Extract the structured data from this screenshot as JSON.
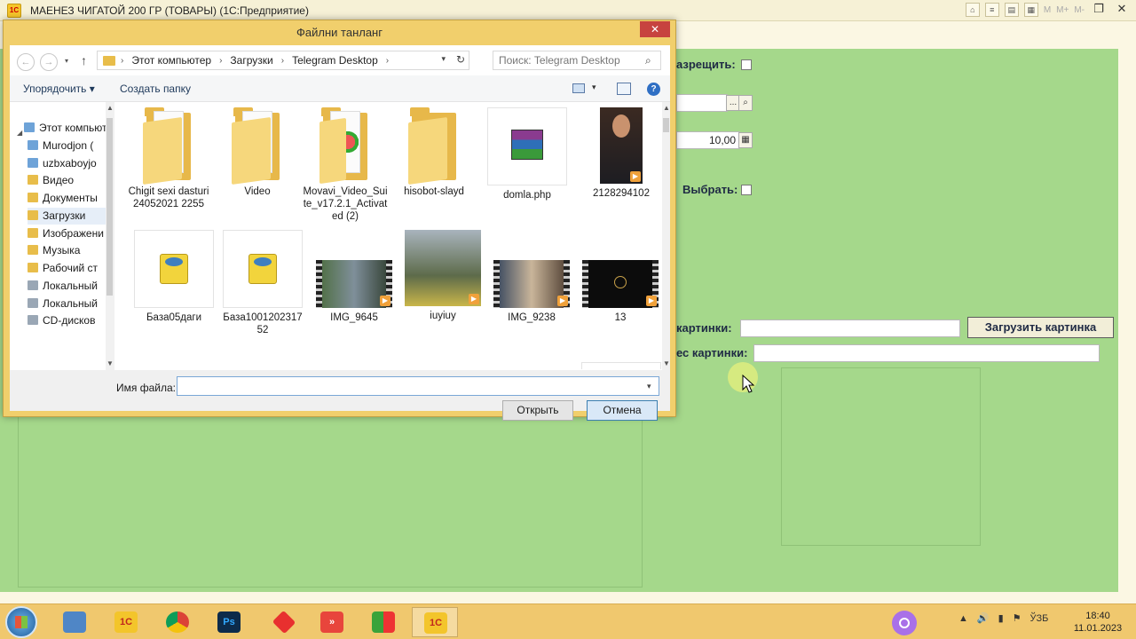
{
  "window": {
    "title": "МАЕНЕЗ ЧИГАТОЙ 200 ГР (ТОВАРЫ)  (1С:Предприятие)",
    "app_icon": "1С",
    "toolbar_m": [
      "M",
      "M+",
      "M-"
    ]
  },
  "form": {
    "fields": {
      "forbid_label": "азрещить:",
      "amount_value": "10,00",
      "select_label": "Выбрать:",
      "picture_label": "картинки:",
      "picture_path_label": "ес картинки:",
      "load_button": "Загрузить картинка",
      "ellipsis": "...",
      "search_glyph": "🔍"
    }
  },
  "dialog": {
    "title": "Файлни танланг",
    "close": "✕",
    "address": [
      "Этот компьютер",
      "Загрузки",
      "Telegram Desktop"
    ],
    "search_placeholder": "Поиск: Telegram Desktop",
    "toolbar": {
      "organize": "Упорядочить ▾",
      "new_folder": "Создать папку",
      "help": "?"
    },
    "nav_items": [
      {
        "label": "Этот компьют"
      },
      {
        "label": "Murodjon ("
      },
      {
        "label": "uzbxaboyjo"
      },
      {
        "label": "Видео"
      },
      {
        "label": "Документы"
      },
      {
        "label": "Загрузки"
      },
      {
        "label": "Изображени"
      },
      {
        "label": "Музыка"
      },
      {
        "label": "Рабочий ст"
      },
      {
        "label": "Локальный"
      },
      {
        "label": "Локальный"
      },
      {
        "label": "CD-дисков"
      }
    ],
    "files": [
      {
        "label": "Chigit sexi dasturi 24052021 2255",
        "kind": "folder"
      },
      {
        "label": "Video",
        "kind": "folder"
      },
      {
        "label": "Movavi_Video_Suite_v17.2.1_Activated (2)",
        "kind": "folder"
      },
      {
        "label": "hisobot-slayd",
        "kind": "folder"
      },
      {
        "label": "domla.php",
        "kind": "archive"
      },
      {
        "label": "2128294102",
        "kind": "video-portrait"
      },
      {
        "label": "База05даги",
        "kind": "db"
      },
      {
        "label": "База100120231752",
        "kind": "db"
      },
      {
        "label": "IMG_9645",
        "kind": "video"
      },
      {
        "label": "iuyiuy",
        "kind": "video-tall"
      },
      {
        "label": "IMG_9238",
        "kind": "video"
      },
      {
        "label": "13",
        "kind": "video-dark"
      }
    ],
    "filename_label": "Имя файла:",
    "filename_value": "",
    "open_button": "Открыть",
    "cancel_button": "Отмена"
  },
  "taskbar": {
    "apps": [
      "Компьютер",
      "1С",
      "Chrome",
      "Ps",
      "AnyDesk",
      "Git",
      "WinRAR",
      "1С"
    ],
    "tray": {
      "lang": "ЎЗБ",
      "time": "18:40",
      "date": "11.01.2023"
    }
  }
}
